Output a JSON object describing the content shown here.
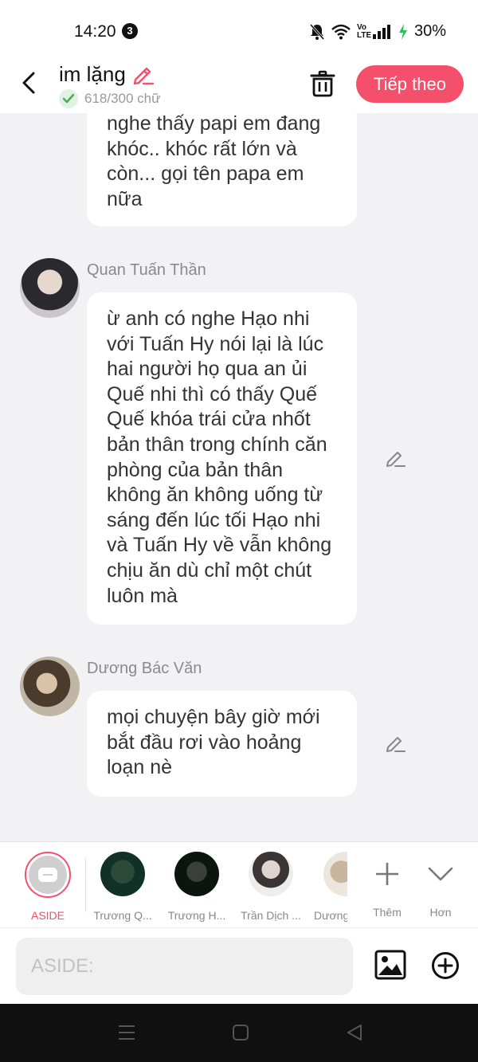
{
  "status_bar": {
    "time": "14:20",
    "notification_count": "3",
    "network_label": "Vo LTE",
    "battery": "30%"
  },
  "header": {
    "title": "im lặng",
    "word_count": "618/300 chữ",
    "next_label": "Tiếp theo"
  },
  "messages": [
    {
      "sender": "",
      "text": "nghe thấy papi em đang khóc.. khóc rất lớn và còn... gọi tên papa em nữa"
    },
    {
      "sender": "Quan Tuấn Thần",
      "text": "ừ anh có nghe Hạo nhi với Tuấn Hy nói lại là lúc hai người họ qua an ủi Quế nhi thì có thấy Quế Quế khóa trái cửa nhốt bản thân trong chính căn phòng của bản thân không ăn không uống từ sáng đến lúc tối Hạo nhi và Tuấn Hy về vẫn không chịu ăn dù chỉ một chút luôn mà"
    },
    {
      "sender": "Dương Bác Văn",
      "text": "mọi chuyện bây giờ mới bắt đầu rơi vào hoảng loạn nè"
    }
  ],
  "characters": {
    "aside_label": "ASIDE",
    "items": [
      {
        "label": "Trương Q..."
      },
      {
        "label": "Trương H..."
      },
      {
        "label": "Trần Dịch ..."
      },
      {
        "label": "Dương"
      }
    ],
    "more_label": "Thêm",
    "expand_label": "Hơn"
  },
  "composer": {
    "placeholder": "ASIDE:"
  },
  "colors": {
    "accent": "#f4506c",
    "check": "#4caf50"
  }
}
